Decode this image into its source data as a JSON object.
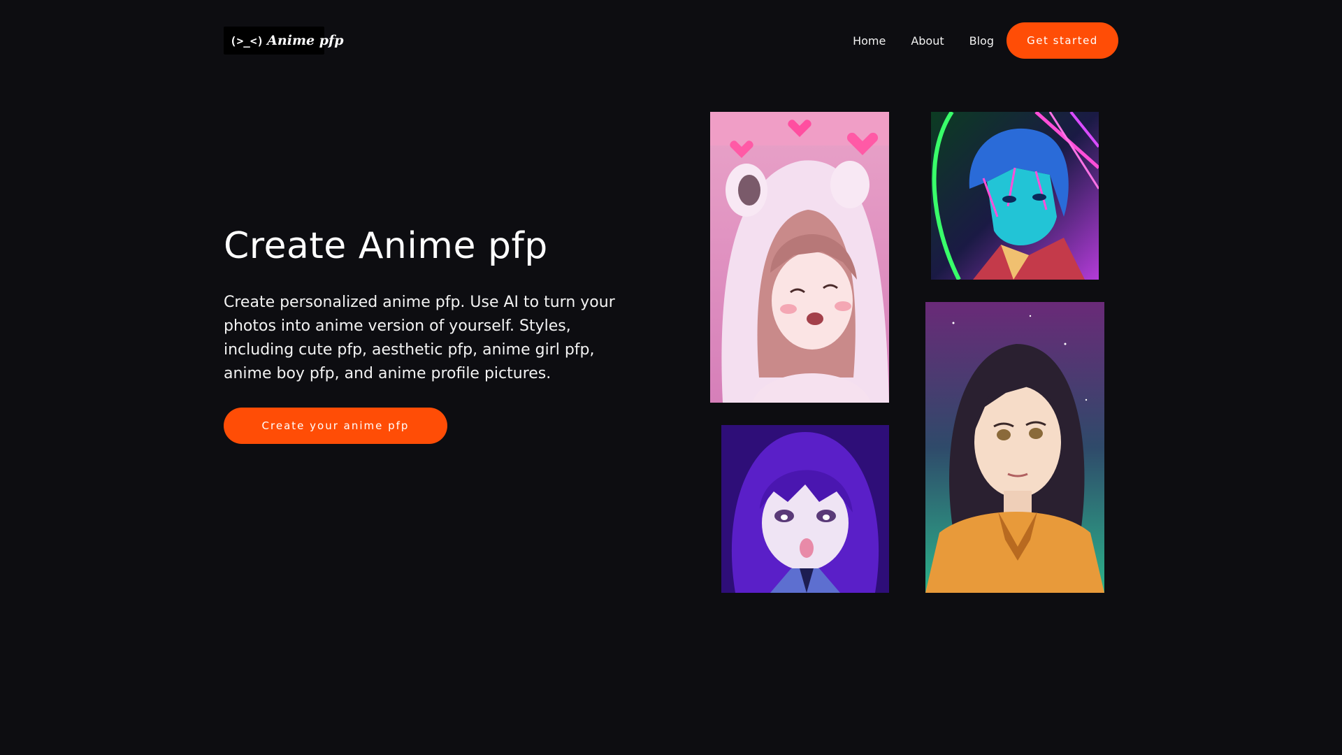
{
  "header": {
    "logo_face": "(>_<)",
    "logo_text": "Anime pfp",
    "nav": [
      "Home",
      "About",
      "Blog"
    ],
    "cta_label": "Get started"
  },
  "hero": {
    "title": "Create Anime pfp",
    "description": "Create personalized anime pfp. Use AI to turn your photos into anime version of yourself. Styles, including cute pfp, aesthetic pfp, anime girl pfp, anime boy pfp, and anime profile pictures.",
    "cta_label": "Create your anime pfp"
  },
  "colors": {
    "background": "#0d0d11",
    "accent": "#ff4d06",
    "text": "#ffffff"
  }
}
